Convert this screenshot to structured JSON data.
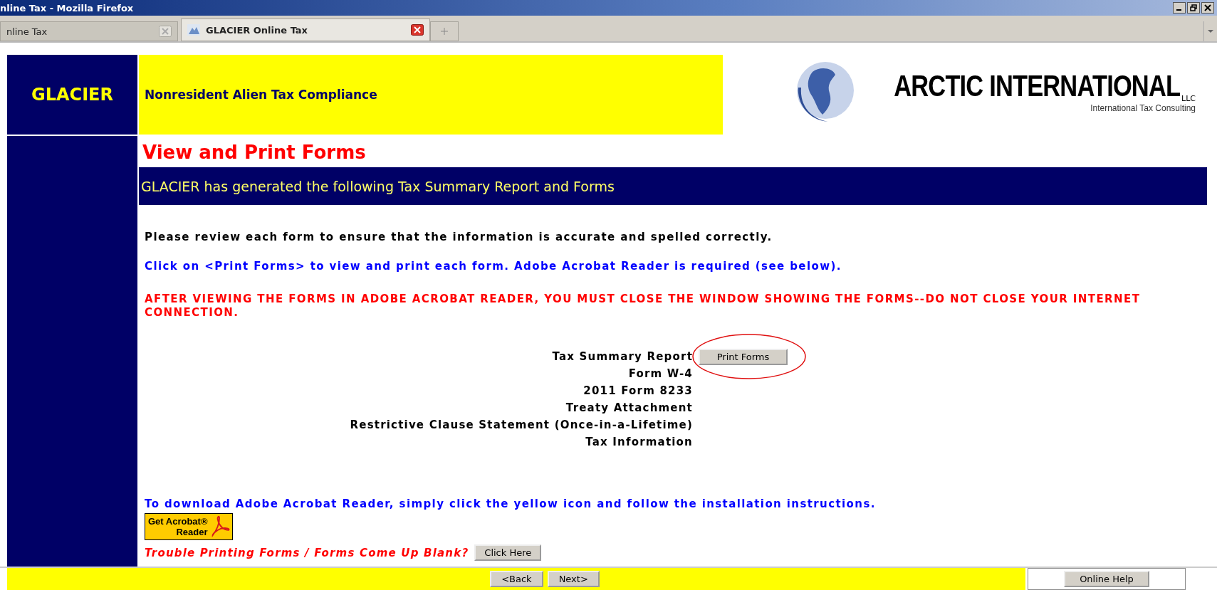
{
  "window": {
    "title": "nline Tax - Mozilla Firefox"
  },
  "tabs": [
    {
      "label": "nline Tax",
      "selected": false
    },
    {
      "label": "GLACIER Online Tax",
      "selected": true
    }
  ],
  "header": {
    "brand": "GLACIER",
    "tagline": "Nonresident Alien Tax Compliance",
    "logo_main": "ARCTIC INTERNATIONAL",
    "logo_suffix": "LLC",
    "logo_sub": "International Tax Consulting"
  },
  "page_title": "View and Print Forms",
  "banner": "GLACIER has generated the following Tax Summary Report and Forms",
  "instructions": [
    {
      "kind": "note",
      "text": "Please review each form to ensure that the information is accurate and spelled correctly."
    },
    {
      "kind": "info",
      "text": "Click on <Print Forms> to view and print each form. Adobe Acrobat Reader is required (see below)."
    },
    {
      "kind": "warning",
      "text": "AFTER VIEWING THE FORMS IN ADOBE ACROBAT READER, YOU MUST CLOSE THE WINDOW SHOWING THE FORMS--DO NOT CLOSE YOUR INTERNET CONNECTION."
    }
  ],
  "forms": [
    {
      "name": "Tax Summary Report",
      "button": "Print Forms"
    },
    {
      "name": "Form W-4"
    },
    {
      "name": "2011 Form 8233"
    },
    {
      "name": "Treaty Attachment"
    },
    {
      "name": "Restrictive Clause Statement (Once-in-a-Lifetime)"
    },
    {
      "name": "Tax Information"
    }
  ],
  "acrobat": {
    "text": "To download Adobe Acrobat Reader, simply click the yellow icon and follow the installation instructions.",
    "badge_line1": "Get Acrobat®",
    "badge_line2": "Reader"
  },
  "trouble": {
    "text": "Trouble Printing Forms / Forms Come Up Blank?",
    "button": "Click Here"
  },
  "footer": {
    "back": "<Back",
    "next": "Next>",
    "help": "Online Help"
  }
}
